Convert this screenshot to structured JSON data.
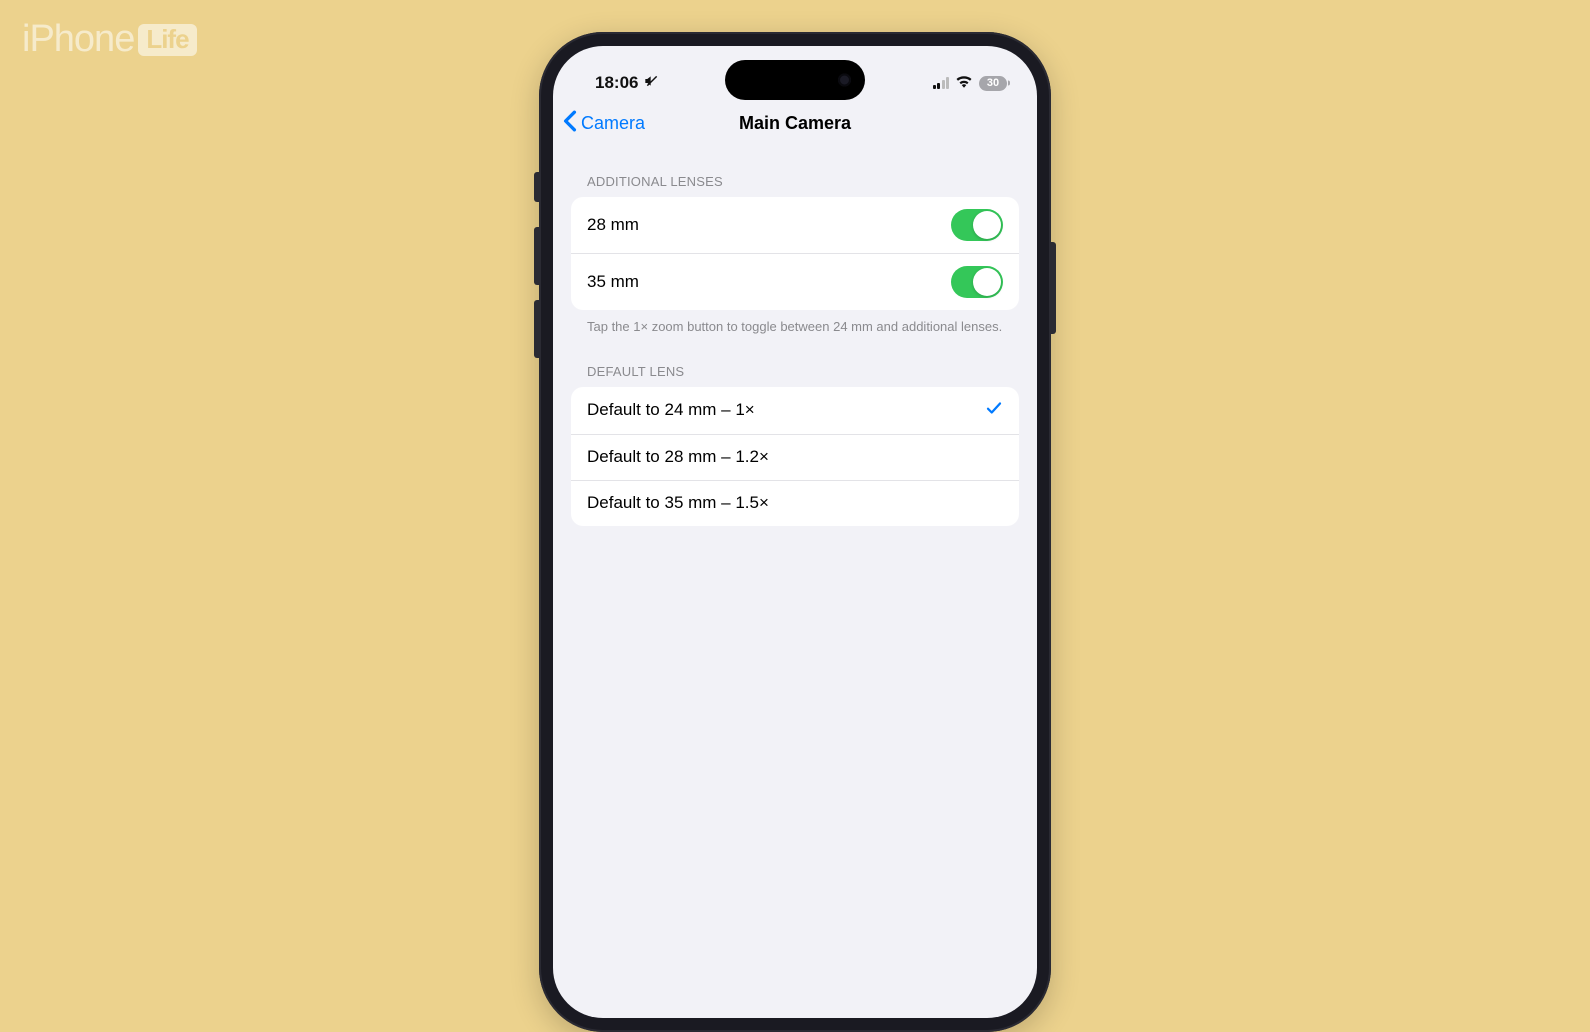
{
  "watermark": {
    "brand": "iPhone",
    "tag": "Life"
  },
  "statusBar": {
    "time": "18:06",
    "battery": "30"
  },
  "nav": {
    "back": "Camera",
    "title": "Main Camera"
  },
  "sections": {
    "additionalLenses": {
      "header": "ADDITIONAL LENSES",
      "rows": [
        {
          "label": "28 mm",
          "on": true
        },
        {
          "label": "35 mm",
          "on": true
        }
      ],
      "footer": "Tap the 1× zoom button to toggle between 24 mm and additional lenses."
    },
    "defaultLens": {
      "header": "DEFAULT LENS",
      "rows": [
        {
          "label": "Default to 24 mm – 1×",
          "selected": true
        },
        {
          "label": "Default to 28 mm – 1.2×",
          "selected": false
        },
        {
          "label": "Default to 35 mm – 1.5×",
          "selected": false
        }
      ]
    }
  }
}
